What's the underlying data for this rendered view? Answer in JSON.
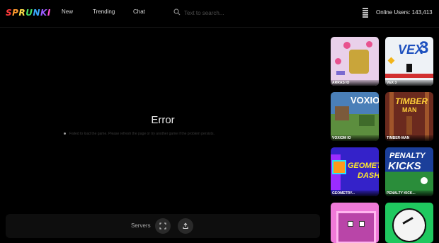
{
  "logo": "SPRUNKI",
  "nav": {
    "new": "New",
    "trending": "Trending",
    "chat": "Chat"
  },
  "search": {
    "placeholder": "Text to search..."
  },
  "online_users": "Online Users: 143,413",
  "error": {
    "title": "Error",
    "message": "Failed to load the game. Please refresh the page or try another game if the problem persists."
  },
  "bottom_bar": {
    "servers_label": "Servers"
  },
  "icons": {
    "search": "search-icon",
    "menu": "menu-icon",
    "fullscreen": "fullscreen-icon",
    "share": "share-icon"
  },
  "colors": {
    "background": "#000000",
    "bar": "#0e0e0e",
    "button": "#2a2a2a"
  },
  "games": [
    {
      "name": "ARRAS IO"
    },
    {
      "name": "VEX 3"
    },
    {
      "name": "VOXIOM IO"
    },
    {
      "name": "TIMBER-MAN"
    },
    {
      "name": "GEOMETRY..."
    },
    {
      "name": "PENALTY KICK..."
    },
    {
      "name": ""
    },
    {
      "name": ""
    }
  ]
}
